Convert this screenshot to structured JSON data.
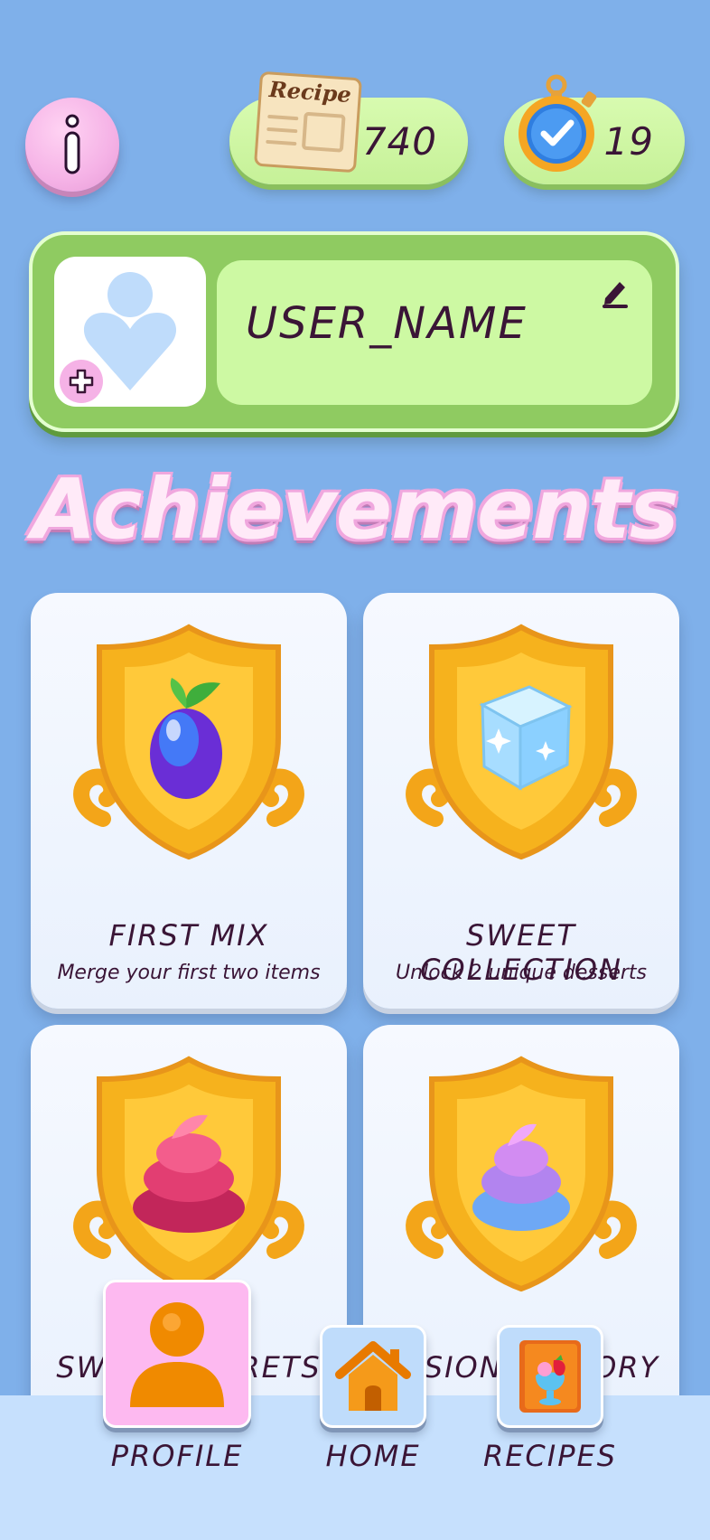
{
  "header": {
    "recipe_count": "740",
    "timer_count": "19",
    "recipe_card_label": "Recipe"
  },
  "profile": {
    "username": "USER_NAME"
  },
  "section_title": "Achievements",
  "achievements": [
    {
      "title": "FIRST MIX",
      "description": "Merge your first two items",
      "icon": "berry-icon"
    },
    {
      "title": "SWEET COLLECTION",
      "description": "Unlock 2 unique desserts",
      "icon": "sugar-cube-icon"
    },
    {
      "title": "SWEET SECRETS",
      "description": "",
      "icon": "pink-cream-icon"
    },
    {
      "title": "FUSION FACTORY",
      "description": "",
      "icon": "purple-cream-icon"
    }
  ],
  "nav": {
    "profile_label": "PROFILE",
    "home_label": "HOME",
    "recipes_label": "RECIPES"
  },
  "colors": {
    "background": "#7fb0ea",
    "panel_green": "#8fcb61",
    "counter_green": "#c6f198",
    "pink": "#f5b2e6",
    "text": "#3a1536"
  }
}
